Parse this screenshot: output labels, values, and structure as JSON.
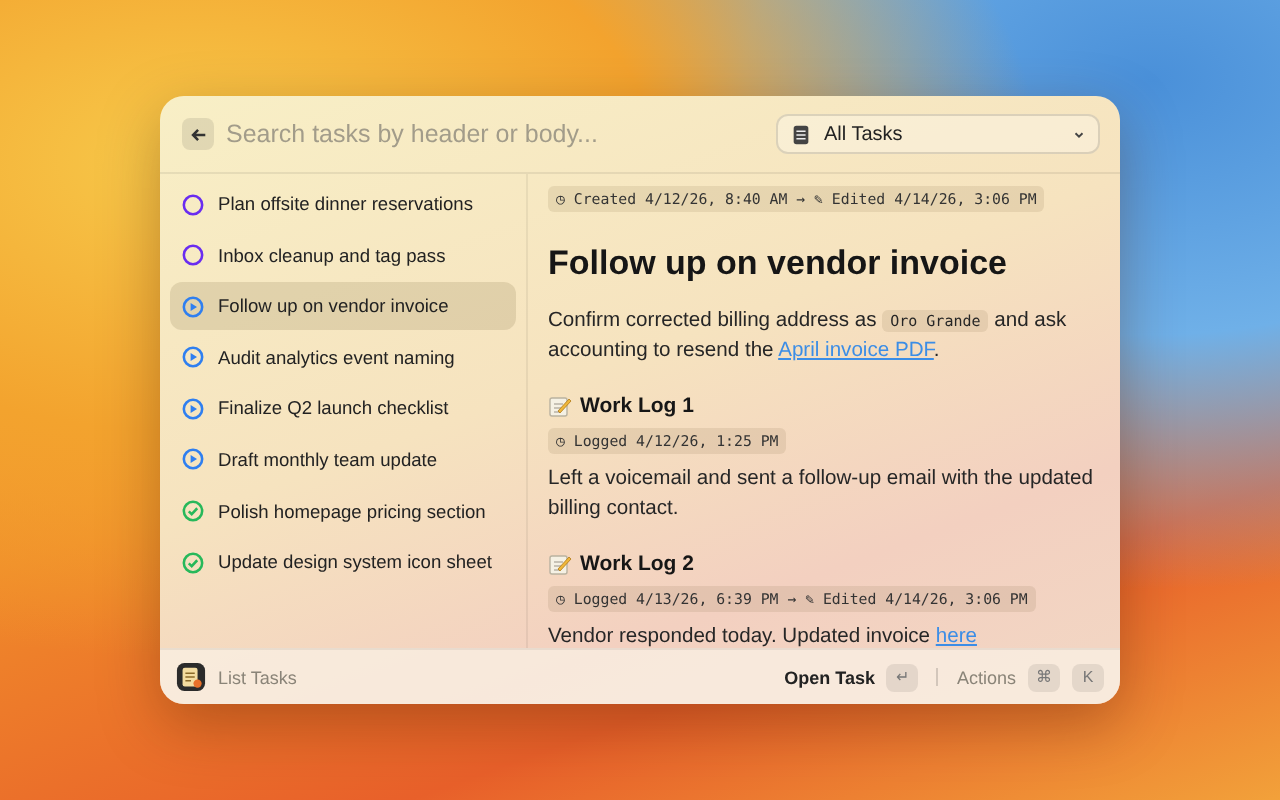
{
  "search": {
    "placeholder": "Search tasks by header or body..."
  },
  "filter": {
    "value": "All Tasks"
  },
  "tasks": [
    {
      "title": "Plan offsite dinner reservations",
      "kind": "todo",
      "color": "#6a2cf0",
      "selected": false
    },
    {
      "title": "Inbox cleanup and tag pass",
      "kind": "todo",
      "color": "#6a2cf0",
      "selected": false
    },
    {
      "title": "Follow up on vendor invoice",
      "kind": "in_progress",
      "color": "#2f7ff0",
      "selected": true
    },
    {
      "title": "Audit analytics event naming",
      "kind": "in_progress",
      "color": "#2f7ff0",
      "selected": false
    },
    {
      "title": "Finalize Q2 launch checklist",
      "kind": "in_progress",
      "color": "#2f7ff0",
      "selected": false
    },
    {
      "title": "Draft monthly team update",
      "kind": "in_progress",
      "color": "#2f7ff0",
      "selected": false
    },
    {
      "title": "Polish homepage pricing section",
      "kind": "done",
      "color": "#27b85a",
      "selected": false
    },
    {
      "title": "Update design system icon sheet",
      "kind": "done",
      "color": "#27b85a",
      "selected": false
    }
  ],
  "detail": {
    "meta": "◷ Created 4/12/26, 8:40 AM → ✎ Edited 4/14/26, 3:06 PM",
    "title": "Follow up on vendor invoice",
    "body": [
      {
        "kind": "text",
        "text": "Confirm corrected billing address as "
      },
      {
        "kind": "code",
        "text": "Oro Grande"
      },
      {
        "kind": "text",
        "text": " and ask accounting to resend the "
      },
      {
        "kind": "link",
        "text": "April invoice PDF"
      },
      {
        "kind": "text",
        "text": "."
      }
    ],
    "logs": [
      {
        "title": "Work Log 1",
        "meta": "◷ Logged 4/12/26, 1:25 PM",
        "body": [
          {
            "kind": "text",
            "text": "Left a voicemail and sent a follow-up email with the updated billing contact."
          }
        ]
      },
      {
        "title": "Work Log 2",
        "meta": "◷ Logged 4/13/26, 6:39 PM → ✎ Edited 4/14/26, 3:06 PM",
        "body": [
          {
            "kind": "text",
            "text": "Vendor responded today. Updated invoice "
          },
          {
            "kind": "link",
            "text": "here"
          }
        ]
      }
    ]
  },
  "footer": {
    "title": "List Tasks",
    "primary_action": "Open Task",
    "primary_key": "↵",
    "actions_label": "Actions",
    "action_keys": [
      "⌘",
      "K"
    ]
  }
}
